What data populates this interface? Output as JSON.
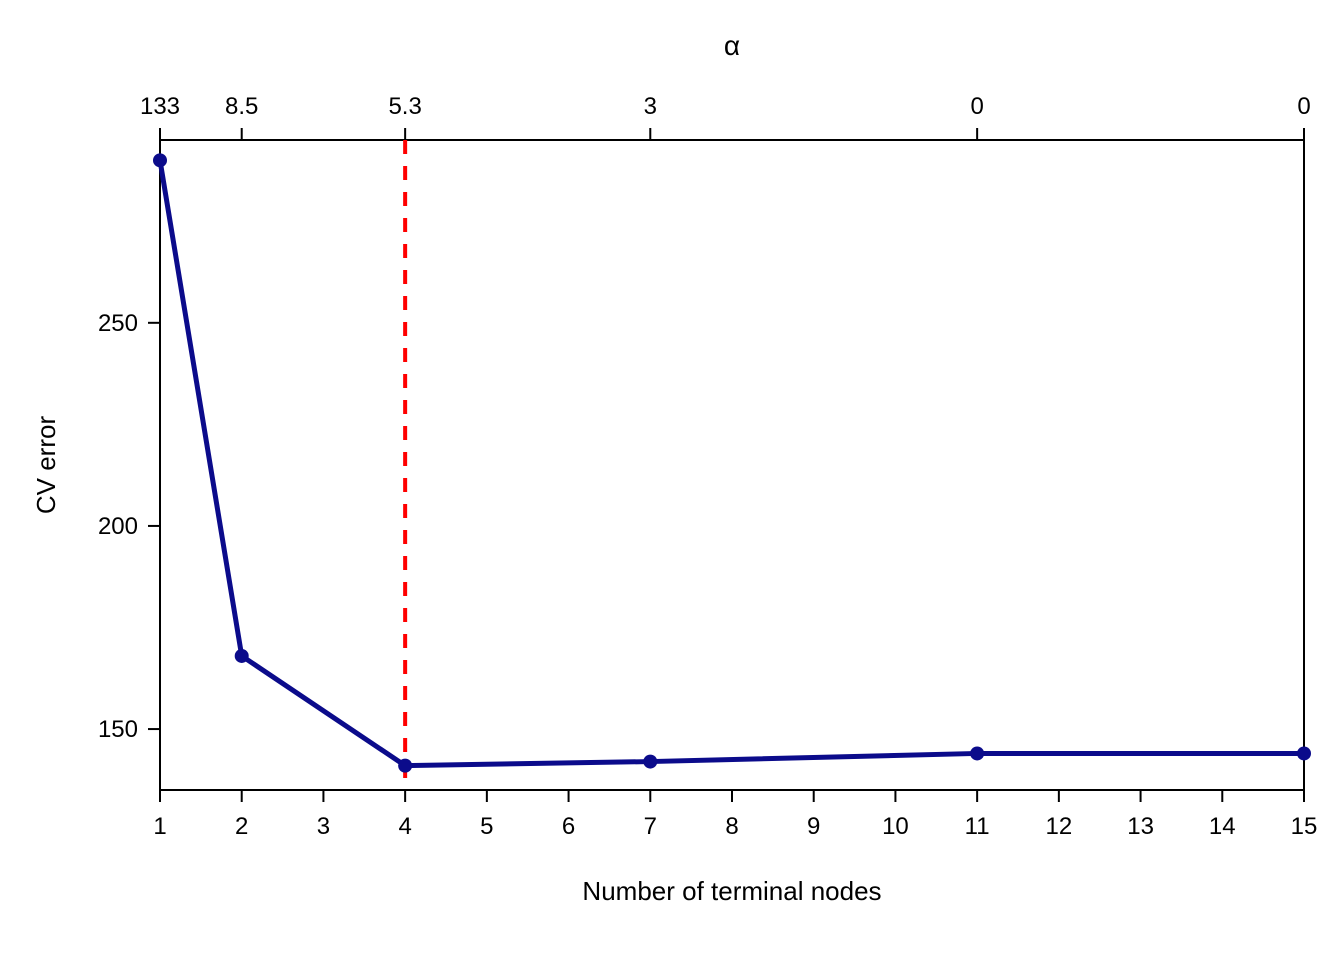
{
  "chart_data": {
    "type": "line",
    "x": [
      1,
      2,
      4,
      7,
      11,
      15
    ],
    "values": [
      290,
      168,
      141,
      142,
      144,
      144
    ],
    "xlabel": "Number of terminal nodes",
    "ylabel": "CV error",
    "top_title": "α",
    "top_ticks": [
      {
        "x": 1,
        "label": "133"
      },
      {
        "x": 2,
        "label": "8.5"
      },
      {
        "x": 4,
        "label": "5.3"
      },
      {
        "x": 7,
        "label": "3"
      },
      {
        "x": 11,
        "label": "0"
      },
      {
        "x": 15,
        "label": "0"
      }
    ],
    "x_ticks": [
      1,
      2,
      3,
      4,
      5,
      6,
      7,
      8,
      9,
      10,
      11,
      12,
      13,
      14,
      15
    ],
    "y_ticks": [
      150,
      200,
      250
    ],
    "xlim": [
      1,
      15
    ],
    "ylim": [
      135,
      295
    ],
    "vline_x": 4,
    "colors": {
      "line": "#0b0b8b",
      "point": "#0b0b8b",
      "vline": "#ff0000",
      "box": "#000000"
    }
  }
}
